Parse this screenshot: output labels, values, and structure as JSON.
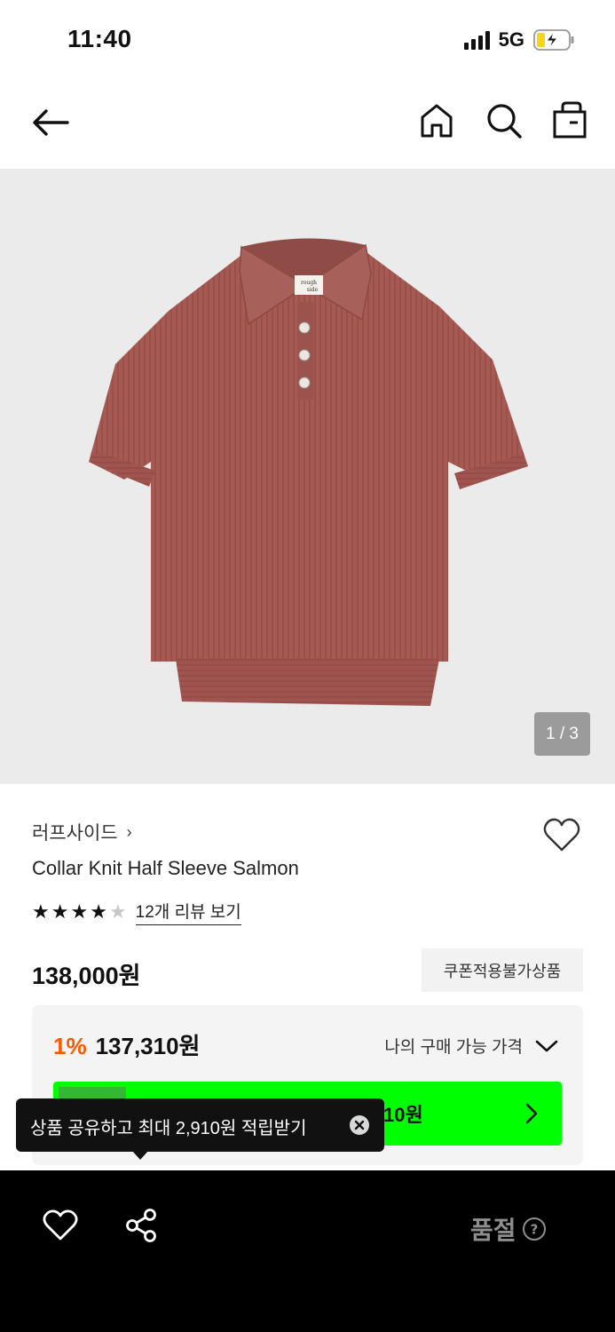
{
  "status": {
    "time": "11:40",
    "network": "5G"
  },
  "hero": {
    "counter": "1 / 3",
    "label_top": "rough",
    "label_bottom": "side"
  },
  "product": {
    "brand": "러프사이드",
    "brand_chevron": "›",
    "name": "Collar Knit Half Sleeve Salmon",
    "rating": 4,
    "rating_max": 5,
    "review_link": "12개 리뷰 보기",
    "price": "138,000원",
    "coupon_badge": "쿠폰적용불가상품"
  },
  "discount": {
    "percent": "1%",
    "price": "137,310원",
    "my_price_label": "나의 구매 가능 가격",
    "button_amount": "10원"
  },
  "tooltip": {
    "text": "상품 공유하고 최대 2,910원 적립받기"
  },
  "bottom": {
    "soldout_label": "품절"
  },
  "colors": {
    "accent_green": "#00ff00",
    "discount_orange": "#ff5a00",
    "product_salmon": "#a65a54"
  },
  "icons": [
    "back-arrow-icon",
    "home-icon",
    "search-icon",
    "shopping-bag-icon",
    "heart-icon",
    "share-icon",
    "close-icon",
    "chevron-down-icon",
    "chevron-right-icon",
    "help-icon"
  ]
}
